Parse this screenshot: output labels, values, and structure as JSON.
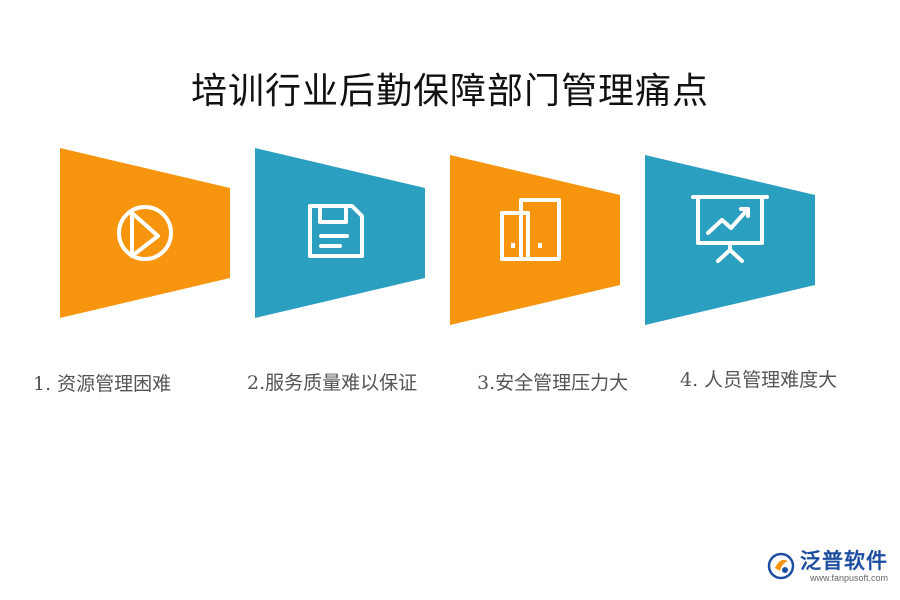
{
  "title": "培训行业后勤保障部门管理痛点",
  "items": [
    {
      "label": "1.  资源管理困难",
      "color": "#f7960e",
      "icon": "pie-chart-icon"
    },
    {
      "label": "2.服务质量难以保证",
      "color": "#2a9fc0",
      "icon": "floppy-disk-icon"
    },
    {
      "label": "3.安全管理压力大",
      "color": "#f7960e",
      "icon": "door-icon"
    },
    {
      "label": "4.  人员管理难度大",
      "color": "#2a9fc0",
      "icon": "presentation-chart-icon"
    }
  ],
  "watermark": {
    "brand": "泛普软件",
    "url": "www.fanpusoft.com"
  }
}
